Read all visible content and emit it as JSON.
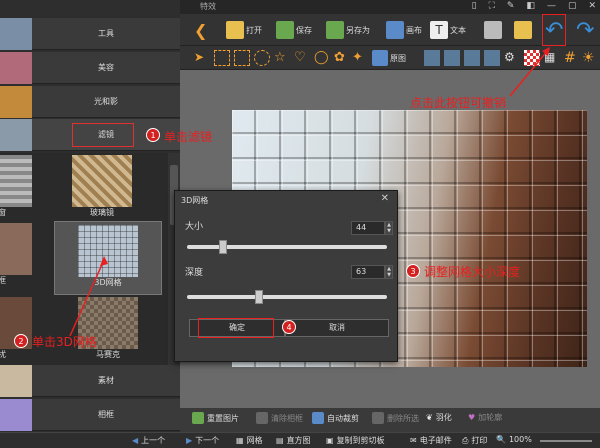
{
  "title": "特效",
  "window_controls": [
    "▯",
    "⛶",
    "✎",
    "◧",
    "—",
    "▢",
    "✕"
  ],
  "left_panel": {
    "categories": [
      {
        "label": "工具",
        "thumb": "#7a8fa5"
      },
      {
        "label": "美容",
        "thumb": "#b06a7a"
      },
      {
        "label": "光和影",
        "thumb": "#c28a3a"
      },
      {
        "label": "滤镜",
        "thumb": "#8a9aa8",
        "selected": true
      },
      {
        "label": "素材",
        "thumb": "#c8b9a0"
      },
      {
        "label": "相框",
        "thumb": "#9a8ad0"
      }
    ],
    "filters": [
      {
        "label": "窗",
        "thumb": "#9a9a9a"
      },
      {
        "label": "玻璃镜",
        "thumb": "#a08050"
      },
      {
        "label": "框",
        "thumb": "#8a6a5a"
      },
      {
        "label": "3D网格",
        "thumb": "#b8c4d0",
        "active": true
      },
      {
        "label": "扰",
        "thumb": "#6a4a3a"
      },
      {
        "label": "马赛克",
        "thumb": "#6a5a4a"
      }
    ]
  },
  "toolbar": {
    "open": "打开",
    "save": "保存",
    "save_as": "另存为",
    "canvas": "画布",
    "text": "文本",
    "original": "原图"
  },
  "dialog": {
    "title": "3D网格",
    "close": "✕",
    "size_label": "大小",
    "size_value": "44",
    "size_fraction": 0.16,
    "depth_label": "深度",
    "depth_value": "63",
    "depth_fraction": 0.34,
    "ok": "确定",
    "cancel": "取消"
  },
  "edit_tools": {
    "reset": "重置图片",
    "clear_mark": "清除相框",
    "auto_crop": "自动裁剪",
    "delete_text": "删除所选",
    "feather": "羽化",
    "add_border": "加轮廓"
  },
  "status": {
    "prev": "上一个",
    "next": "下一个",
    "grid": "网格",
    "histogram": "直方图",
    "copy": "复制到剪切板",
    "email": "电子邮件",
    "print": "打印",
    "zoom": "100%"
  },
  "annotations": {
    "n1": "1",
    "t1": "单击滤镜",
    "n2": "2",
    "t2": "单击3D网格",
    "n3": "3",
    "t3": "调整网格大小深度",
    "n4": "4",
    "undo_tip": "点击此按钮可撤销"
  },
  "colors": {
    "accent_red": "#e82020",
    "undo_blue": "#3a8fd8"
  }
}
